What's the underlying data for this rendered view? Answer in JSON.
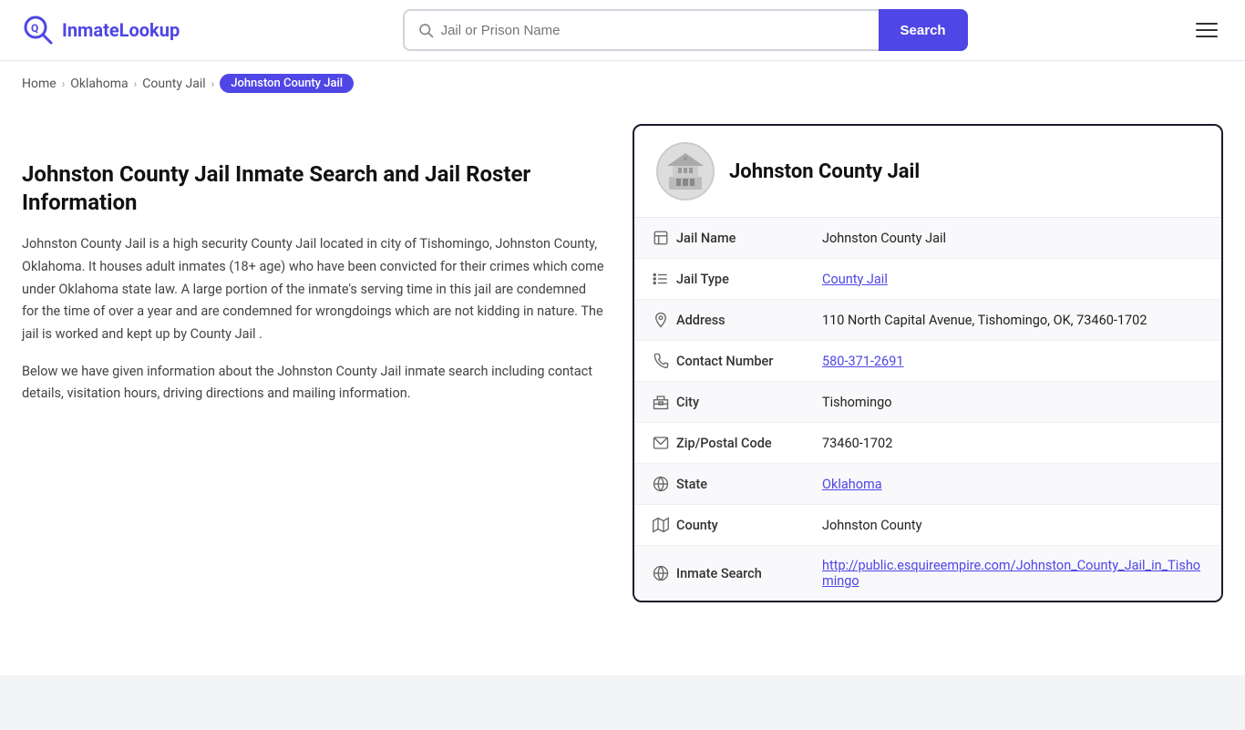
{
  "header": {
    "logo_text_part1": "Inmate",
    "logo_text_part2": "Lookup",
    "search_placeholder": "Jail or Prison Name",
    "search_button_label": "Search"
  },
  "breadcrumb": {
    "items": [
      {
        "label": "Home",
        "href": "#"
      },
      {
        "label": "Oklahoma",
        "href": "#"
      },
      {
        "label": "County Jail",
        "href": "#"
      },
      {
        "label": "Johnston County Jail",
        "active": true
      }
    ]
  },
  "left": {
    "page_title": "Johnston County Jail Inmate Search and Jail Roster Information",
    "desc1": "Johnston County Jail is a high security County Jail located in city of Tishomingo, Johnston County, Oklahoma. It houses adult inmates (18+ age) who have been convicted for their crimes which come under Oklahoma state law. A large portion of the inmate's serving time in this jail are condemned for the time of over a year and are condemned for wrongdoings which are not kidding in nature. The jail is worked and kept up by County Jail .",
    "desc2": "Below we have given information about the Johnston County Jail inmate search including contact details, visitation hours, driving directions and mailing information."
  },
  "card": {
    "title": "Johnston County Jail",
    "rows": [
      {
        "icon": "jail-icon",
        "label": "Jail Name",
        "value": "Johnston County Jail",
        "link": false
      },
      {
        "icon": "list-icon",
        "label": "Jail Type",
        "value": "County Jail",
        "link": true,
        "href": "#"
      },
      {
        "icon": "pin-icon",
        "label": "Address",
        "value": "110 North Capital Avenue, Tishomingo, OK, 73460-1702",
        "link": false
      },
      {
        "icon": "phone-icon",
        "label": "Contact Number",
        "value": "580-371-2691",
        "link": true,
        "href": "tel:580-371-2691"
      },
      {
        "icon": "city-icon",
        "label": "City",
        "value": "Tishomingo",
        "link": false
      },
      {
        "icon": "mail-icon",
        "label": "Zip/Postal Code",
        "value": "73460-1702",
        "link": false
      },
      {
        "icon": "globe-icon",
        "label": "State",
        "value": "Oklahoma",
        "link": true,
        "href": "#"
      },
      {
        "icon": "map-icon",
        "label": "County",
        "value": "Johnston County",
        "link": false
      },
      {
        "icon": "globe2-icon",
        "label": "Inmate Search",
        "value": "http://public.esquireempire.com/Johnston_County_Jail_in_Tishomingo",
        "link": true,
        "href": "#"
      }
    ]
  }
}
